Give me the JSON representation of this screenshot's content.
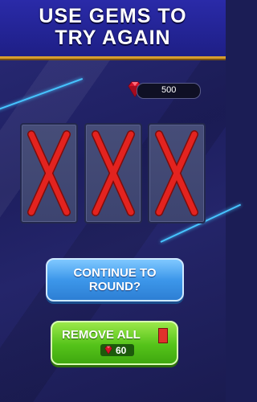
{
  "header": {
    "title": "USE GEMS TO\nTRY AGAIN"
  },
  "wallet": {
    "gem_icon": "ruby-gem-icon",
    "gems": "500"
  },
  "cards": [
    {
      "mark": "red-x"
    },
    {
      "mark": "red-x"
    },
    {
      "mark": "red-x"
    }
  ],
  "buttons": {
    "continue_label": "CONTINUE TO\nROUND?",
    "remove_label": "REMOVE ALL",
    "remove_cost": "60"
  },
  "colors": {
    "header": "#2426a0",
    "header_border": "#d89d2e",
    "x_mark": "#e3231f",
    "continue_button": "#3d97ea",
    "remove_button": "#55c31a"
  }
}
